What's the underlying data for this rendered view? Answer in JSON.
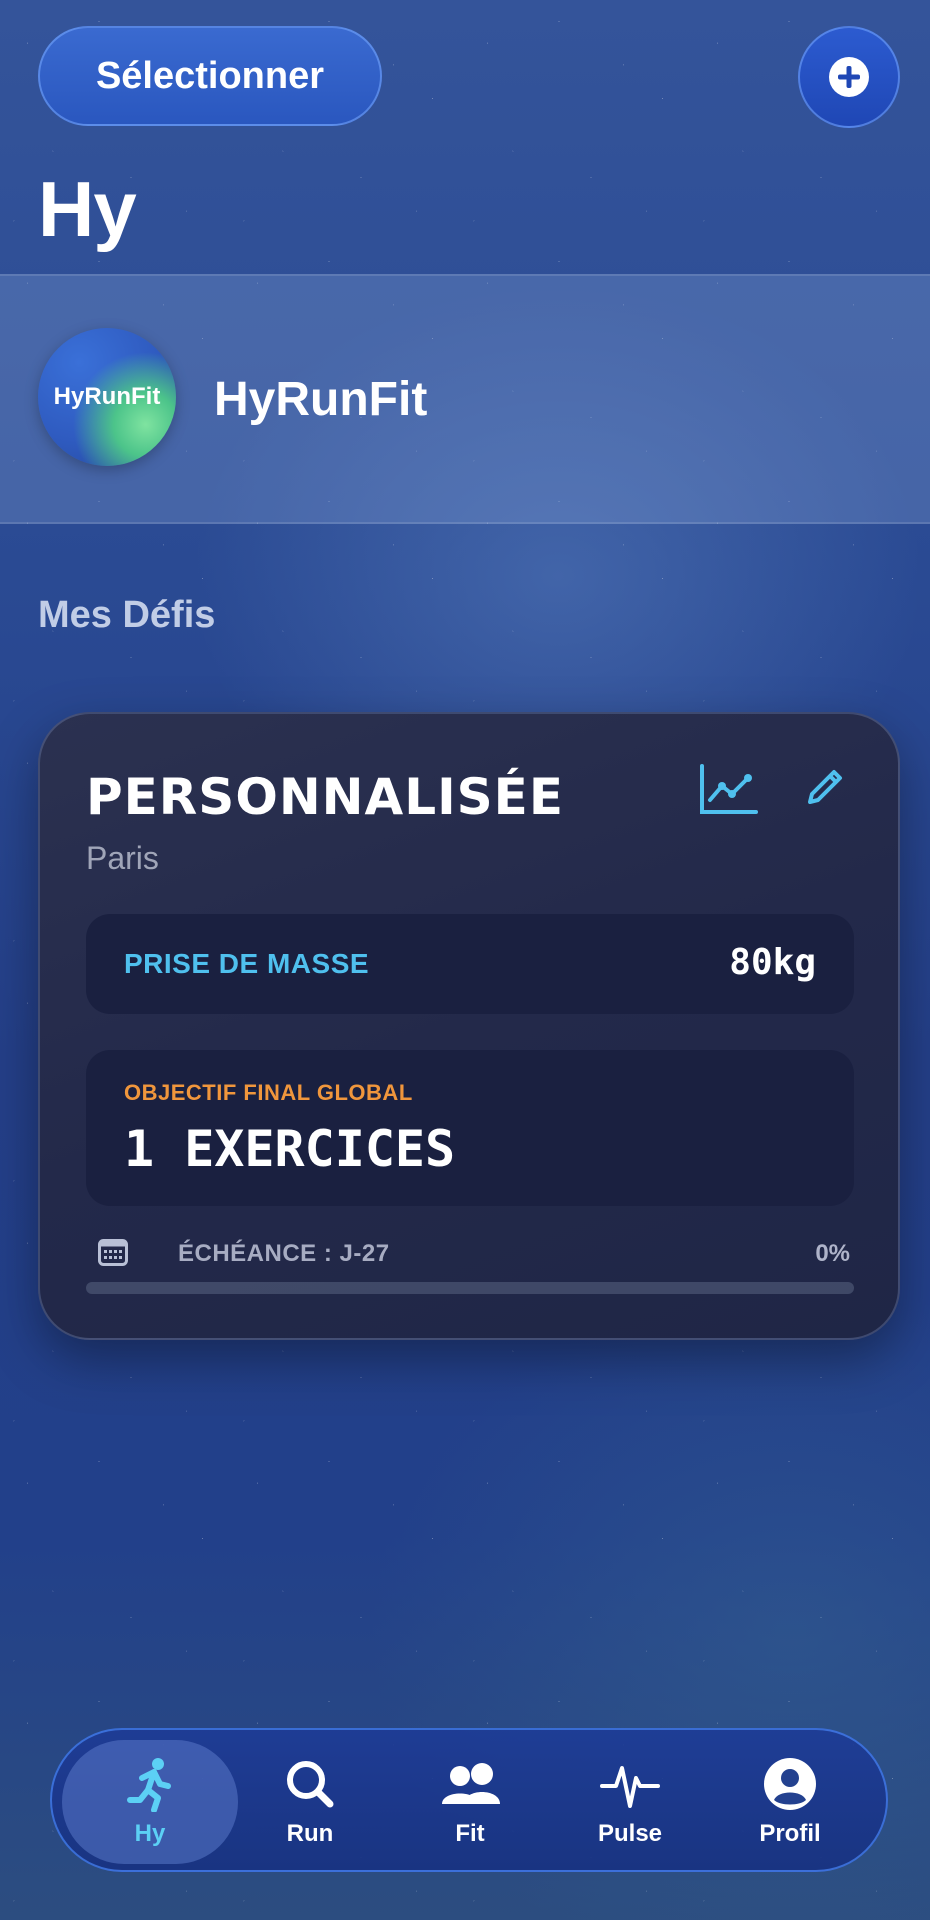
{
  "header": {
    "select_label": "Sélectionner",
    "add_icon": "plus-circle-icon",
    "title": "Hy"
  },
  "group": {
    "avatar_text": "HyRunFit",
    "name": "HyRunFit"
  },
  "section": {
    "title": "Mes Défis"
  },
  "challenge": {
    "title": "PERSONNALISÉE",
    "location": "Paris",
    "metric_label": "PRISE DE MASSE",
    "metric_value": "80kg",
    "goal_label": "OBJECTIF FINAL GLOBAL",
    "goal_value": "1 EXERCICES",
    "deadline": "ÉCHÉANCE : J-27",
    "progress_text": "0%",
    "progress_fraction": 0,
    "icons": [
      "chart-icon",
      "pencil-icon",
      "calendar-icon"
    ]
  },
  "tabbar": {
    "tabs": [
      {
        "label": "Hy",
        "icon": "runner-icon",
        "active": true
      },
      {
        "label": "Run",
        "icon": "search-icon",
        "active": false
      },
      {
        "label": "Fit",
        "icon": "people-icon",
        "active": false
      },
      {
        "label": "Pulse",
        "icon": "pulse-icon",
        "active": false
      },
      {
        "label": "Profil",
        "icon": "profile-icon",
        "active": false
      }
    ]
  },
  "colors": {
    "accent_blue": "#4fc0ee",
    "accent_orange": "#f0963c",
    "active_tab_label": "#5cd0f5"
  }
}
